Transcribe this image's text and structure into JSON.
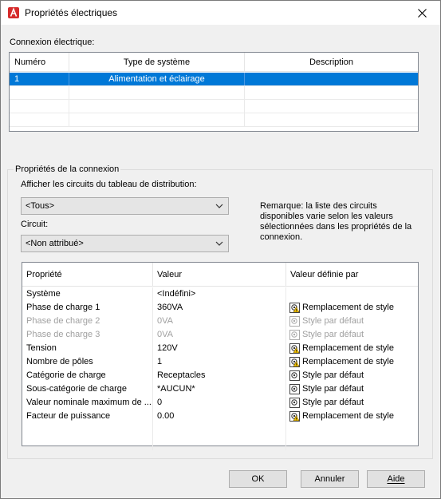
{
  "window": {
    "title": "Propriétés électriques",
    "colors": {
      "selection": "#0078d7",
      "warning": "#f2c200"
    }
  },
  "connexion": {
    "label": "Connexion électrique:",
    "columns": [
      "Numéro",
      "Type de système",
      "Description"
    ],
    "rows": [
      {
        "numero": "1",
        "type": "Alimentation et éclairage",
        "description": ""
      }
    ]
  },
  "props_group": {
    "legend": "Propriétés de la connexion",
    "panel_label": "Afficher les circuits du tableau de distribution:",
    "panel_value": "<Tous>",
    "circuit_label": "Circuit:",
    "circuit_value": "<Non attribué>",
    "note": "Remarque: la liste des circuits disponibles varie selon les valeurs sélectionnées dans les propriétés de la connexion."
  },
  "grid": {
    "columns": [
      "Propriété",
      "Valeur",
      "Valeur définie par"
    ],
    "rows": [
      {
        "prop": "Système",
        "value": "<Indéfini>",
        "source": "",
        "icon": "",
        "disabled": false
      },
      {
        "prop": "Phase de charge 1",
        "value": "360VA",
        "source": "Remplacement de style",
        "icon": "override-warning-icon",
        "disabled": false
      },
      {
        "prop": "Phase de charge 2",
        "value": "0VA",
        "source": "Style par défaut",
        "icon": "style-default-icon",
        "disabled": true
      },
      {
        "prop": "Phase de charge 3",
        "value": "0VA",
        "source": "Style par défaut",
        "icon": "style-default-icon",
        "disabled": true
      },
      {
        "prop": "Tension",
        "value": "120V",
        "source": "Remplacement de style",
        "icon": "override-warning-icon",
        "disabled": false
      },
      {
        "prop": "Nombre de pôles",
        "value": "1",
        "source": "Remplacement de style",
        "icon": "override-warning-icon",
        "disabled": false
      },
      {
        "prop": "Catégorie de charge",
        "value": "Receptacles",
        "source": "Style par défaut",
        "icon": "style-default-icon",
        "disabled": false
      },
      {
        "prop": "Sous-catégorie de charge",
        "value": "*AUCUN*",
        "source": "Style par défaut",
        "icon": "style-default-icon",
        "disabled": false
      },
      {
        "prop": "Valeur nominale maximum de ...",
        "value": "0",
        "source": "Style par défaut",
        "icon": "style-default-icon",
        "disabled": false
      },
      {
        "prop": "Facteur de puissance",
        "value": "0.00",
        "source": "Remplacement de style",
        "icon": "override-warning-icon",
        "disabled": false
      }
    ]
  },
  "buttons": {
    "ok": "OK",
    "cancel": "Annuler",
    "help": "Aide"
  }
}
